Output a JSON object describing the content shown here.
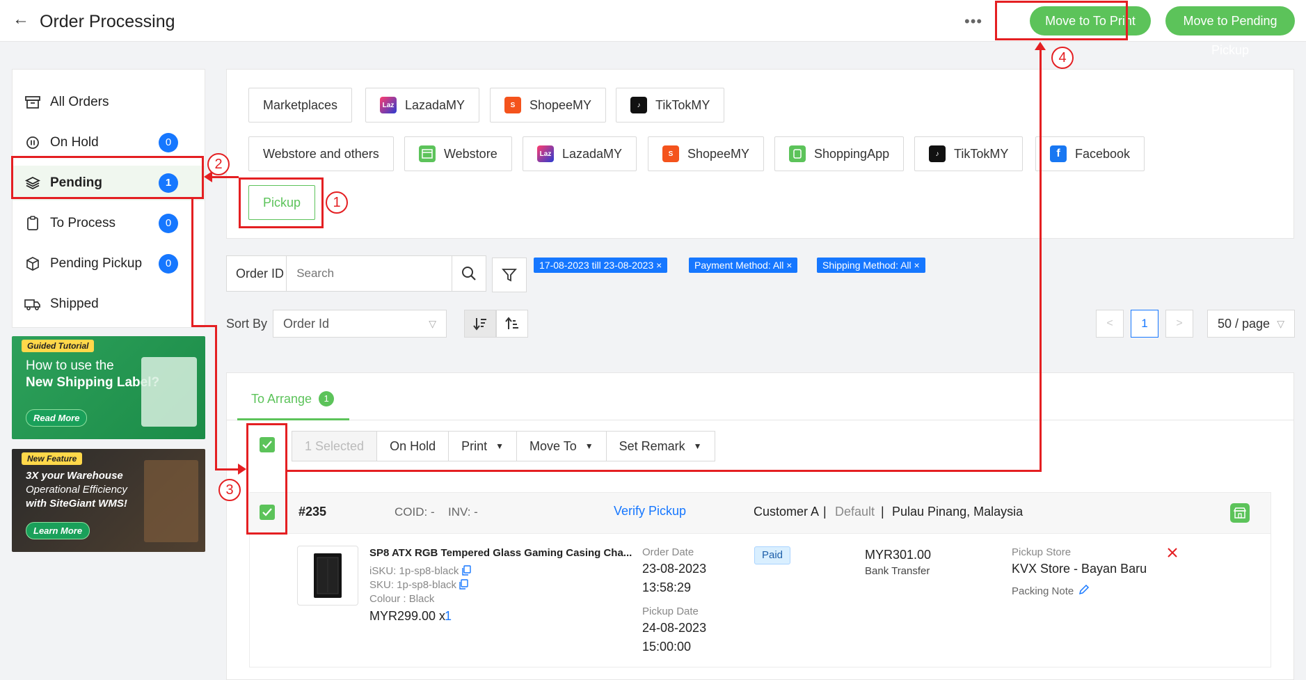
{
  "header": {
    "title": "Order Processing",
    "more": "•••",
    "move_to_print": "Move to To Print",
    "move_to_pending_pickup": "Move to Pending Pickup"
  },
  "sidebar": {
    "items": [
      {
        "label": "All Orders",
        "count": ""
      },
      {
        "label": "On Hold",
        "count": "0"
      },
      {
        "label": "Pending",
        "count": "1"
      },
      {
        "label": "To Process",
        "count": "0"
      },
      {
        "label": "Pending Pickup",
        "count": "0"
      },
      {
        "label": "Shipped",
        "count": ""
      }
    ]
  },
  "banners": {
    "guided": {
      "tag": "Guided Tutorial",
      "line1": "How to use the",
      "line2": "New Shipping Label?",
      "cta": "Read More"
    },
    "feature": {
      "tag": "New Feature",
      "line1": "3X your Warehouse",
      "line2": "Operational Efficiency",
      "line3": "with SiteGiant WMS!",
      "cta": "Learn More"
    }
  },
  "channels": {
    "row1": [
      "Marketplaces",
      "LazadaMY",
      "ShopeeMY",
      "TikTokMY"
    ],
    "row2": [
      "Webstore and others",
      "Webstore",
      "LazadaMY",
      "ShopeeMY",
      "ShoppingApp",
      "TikTokMY",
      "Facebook"
    ],
    "pickup": "Pickup",
    "logo_text": {
      "lazada": "Laz",
      "shopee": "S",
      "tiktok": "♪"
    }
  },
  "search": {
    "label": "Order ID",
    "placeholder": "Search",
    "tags": [
      "17-08-2023 till 23-08-2023 ×",
      "Payment Method: All ×",
      "Shipping Method: All ×"
    ]
  },
  "sort": {
    "label": "Sort By",
    "value": "Order Id",
    "page": "1",
    "page_size": "50 / page"
  },
  "tabs": {
    "to_arrange": "To Arrange",
    "to_arrange_count": "1"
  },
  "actions": {
    "selected": "1 Selected",
    "on_hold": "On Hold",
    "print": "Print",
    "move_to": "Move To",
    "set_remark": "Set Remark"
  },
  "order": {
    "id": "#235",
    "coid": "COID: -",
    "inv": "INV: -",
    "verify": "Verify Pickup",
    "customer": "Customer A",
    "sep": "|",
    "address_default": "Default",
    "location": "Pulau Pinang, Malaysia",
    "product_name": "SP8 ATX RGB Tempered Glass Gaming Casing Cha...",
    "isku": "iSKU: 1p-sp8-black",
    "sku": "SKU: 1p-sp8-black",
    "colour": "Colour : Black",
    "price": "MYR299.00 x",
    "qty": "1",
    "order_date_label": "Order Date",
    "order_date": "23-08-2023",
    "order_time": "13:58:29",
    "pickup_date_label": "Pickup Date",
    "pickup_date": "24-08-2023",
    "pickup_time": "15:00:00",
    "status": "Paid",
    "total": "MYR301.00",
    "payment": "Bank Transfer",
    "store_label": "Pickup Store",
    "store": "KVX Store - Bayan Baru",
    "packing_note": "Packing Note"
  },
  "annotations": [
    "1",
    "2",
    "3",
    "4"
  ],
  "colors": {
    "green": "#5cc35a",
    "blue": "#1677ff",
    "red": "#e41f22"
  }
}
